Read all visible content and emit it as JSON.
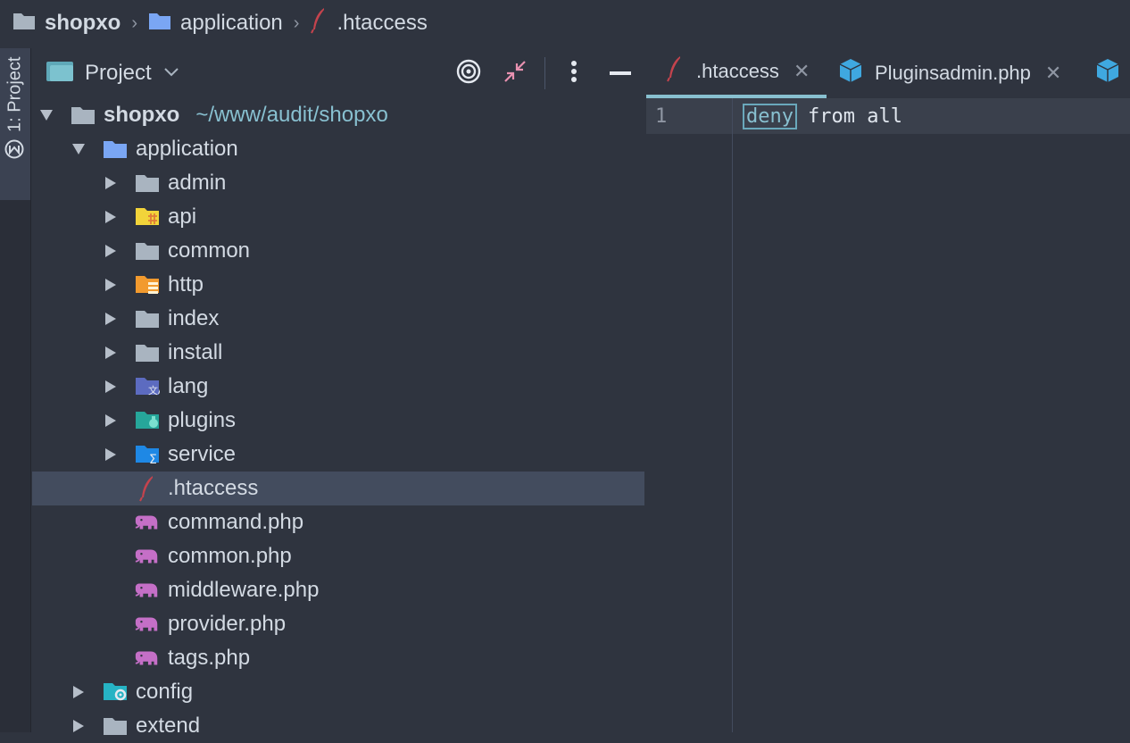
{
  "breadcrumb": {
    "project": "shopxo",
    "folder": "application",
    "file": ".htaccess"
  },
  "toolstrip": {
    "project_label": "1: Project",
    "structure_icon": "m-circle-icon"
  },
  "project_panel": {
    "title": "Project",
    "tree": [
      {
        "label": "shopxo",
        "path": "~/www/audit/shopxo",
        "icon": "folder-icon"
      },
      {
        "label": "application",
        "icon": "folder-blue-icon"
      },
      {
        "label": "admin",
        "icon": "folder-icon"
      },
      {
        "label": "api",
        "icon": "folder-api-icon"
      },
      {
        "label": "common",
        "icon": "folder-icon"
      },
      {
        "label": "http",
        "icon": "folder-http-icon"
      },
      {
        "label": "index",
        "icon": "folder-icon"
      },
      {
        "label": "install",
        "icon": "folder-icon"
      },
      {
        "label": "lang",
        "icon": "folder-lang-icon"
      },
      {
        "label": "plugins",
        "icon": "folder-plugins-icon"
      },
      {
        "label": "service",
        "icon": "folder-service-icon"
      },
      {
        "label": ".htaccess",
        "icon": "feather-icon"
      },
      {
        "label": "command.php",
        "icon": "php-elephant-icon"
      },
      {
        "label": "common.php",
        "icon": "php-elephant-icon"
      },
      {
        "label": "middleware.php",
        "icon": "php-elephant-icon"
      },
      {
        "label": "provider.php",
        "icon": "php-elephant-icon"
      },
      {
        "label": "tags.php",
        "icon": "php-elephant-icon"
      },
      {
        "label": "config",
        "icon": "folder-config-icon"
      },
      {
        "label": "extend",
        "icon": "folder-icon"
      }
    ]
  },
  "editor": {
    "tabs": [
      {
        "label": ".htaccess"
      },
      {
        "label": "Pluginsadmin.php"
      }
    ],
    "line_number": "1",
    "code": {
      "keyword": "deny",
      "rest": "from all"
    }
  },
  "colors": {
    "background": "#2f343f",
    "accent": "#88c0d0",
    "selection": "#434c5e",
    "php_icon": "#c56fc7",
    "feather": "#c4434d"
  }
}
